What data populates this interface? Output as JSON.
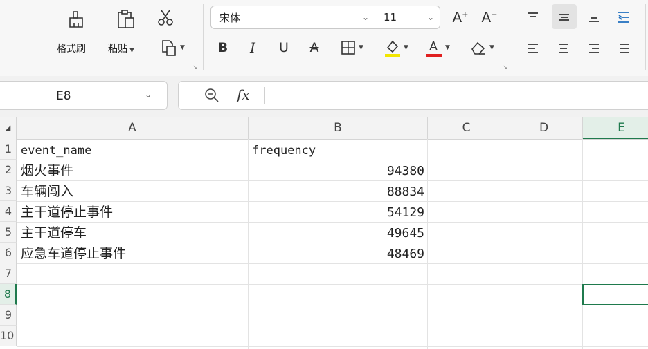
{
  "clipboard": {
    "format_painter": "格式刷",
    "paste": "粘贴"
  },
  "font": {
    "name": "宋体",
    "size": "11"
  },
  "name_box": "E8",
  "columns": [
    "A",
    "B",
    "C",
    "D",
    "E"
  ],
  "rows": [
    "1",
    "2",
    "3",
    "4",
    "5",
    "6",
    "7",
    "8",
    "9",
    "10"
  ],
  "sheet": {
    "header": {
      "a": "event_name",
      "b": "frequency"
    },
    "data": [
      {
        "a": "烟火事件",
        "b": "94380"
      },
      {
        "a": "车辆闯入",
        "b": "88834"
      },
      {
        "a": "主干道停止事件",
        "b": "54129"
      },
      {
        "a": "主干道停车",
        "b": "49645"
      },
      {
        "a": "应急车道停止事件",
        "b": "48469"
      }
    ]
  },
  "colors": {
    "highlight": "#f2e600",
    "font_color": "#e02020",
    "selection": "#1f7a4d"
  },
  "icons": [
    "format-painter-icon",
    "paste-icon",
    "cut-icon",
    "copy-icon",
    "bold-icon",
    "italic-icon",
    "underline-icon",
    "strikethrough-icon",
    "border-icon",
    "highlight-icon",
    "font-color-icon",
    "eraser-icon",
    "increase-font-icon",
    "decrease-font-icon",
    "align-top-icon",
    "align-middle-icon",
    "align-bottom-icon",
    "indent-icon",
    "align-left-icon",
    "align-center-icon",
    "align-right-icon",
    "justify-icon",
    "zoom-icon",
    "fx-icon"
  ]
}
